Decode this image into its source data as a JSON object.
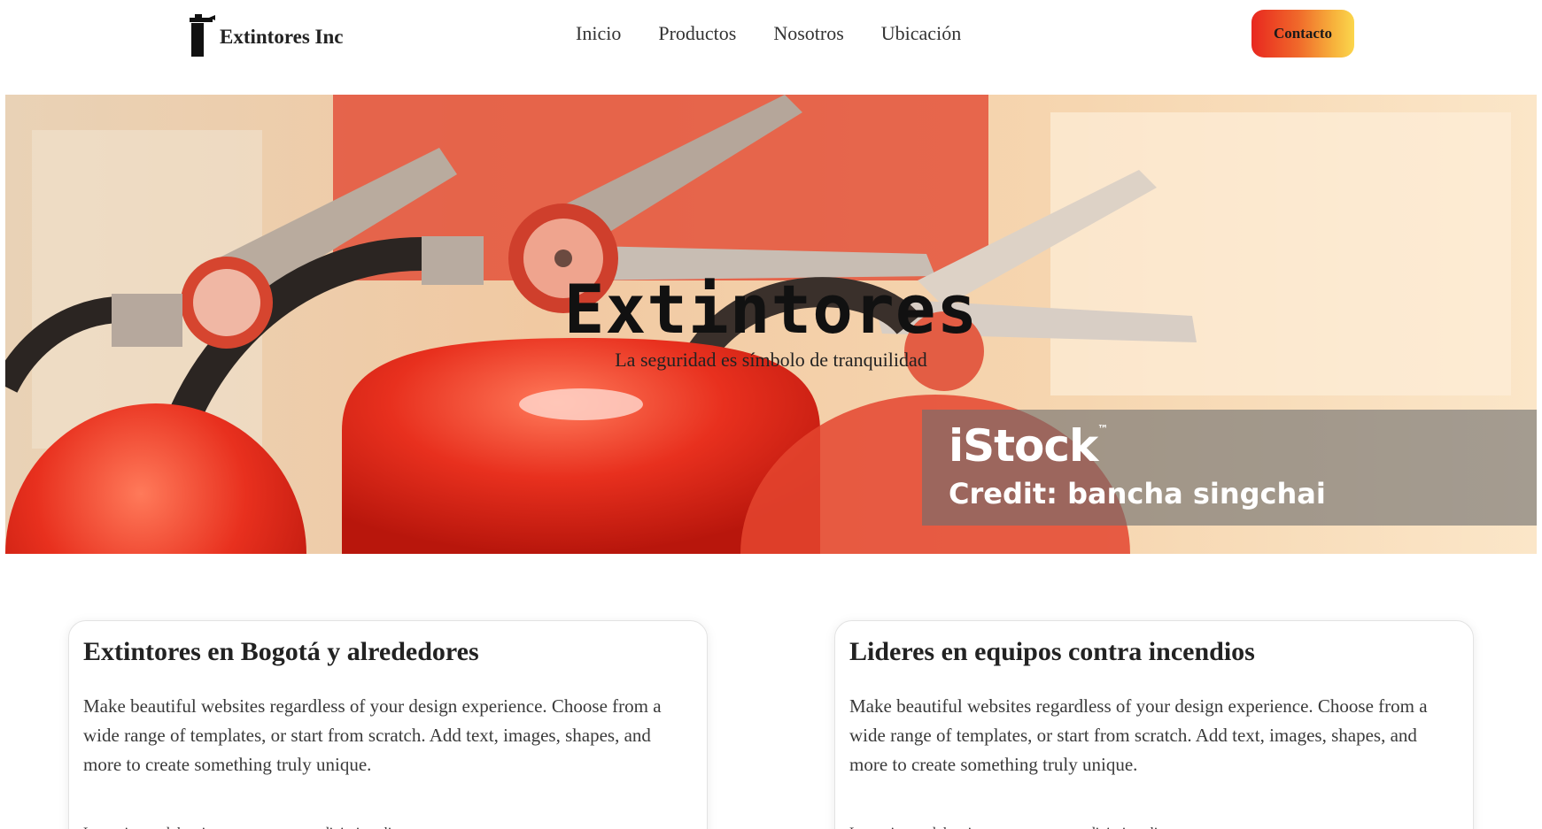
{
  "header": {
    "brand_name": "Extintores Inc",
    "nav": [
      "Inicio",
      "Productos",
      "Nosotros",
      "Ubicación"
    ],
    "contact_label": "Contacto"
  },
  "hero": {
    "title": "Extintores",
    "subtitle": "La seguridad es símbolo de tranquilidad",
    "watermark_brand": "iStock",
    "watermark_credit": "Credit: bancha singchai"
  },
  "cards": [
    {
      "title": "Extintores en Bogotá y alrededores",
      "body": "Make beautiful websites regardless of your design experience. Choose from a wide range of templates, or start from scratch. Add text, images, shapes, and more to create something truly unique.",
      "footer": "Lorem ipsum dolor sit amet, consectetur adipiscing elit"
    },
    {
      "title": "Lideres en equipos contra incendios",
      "body": "Make beautiful websites regardless of your design experience. Choose from a wide range of templates, or start from scratch. Add text, images, shapes, and more to create something truly unique.",
      "footer": "Lorem ipsum dolor sit amet, consectetur adipiscing elit"
    }
  ]
}
